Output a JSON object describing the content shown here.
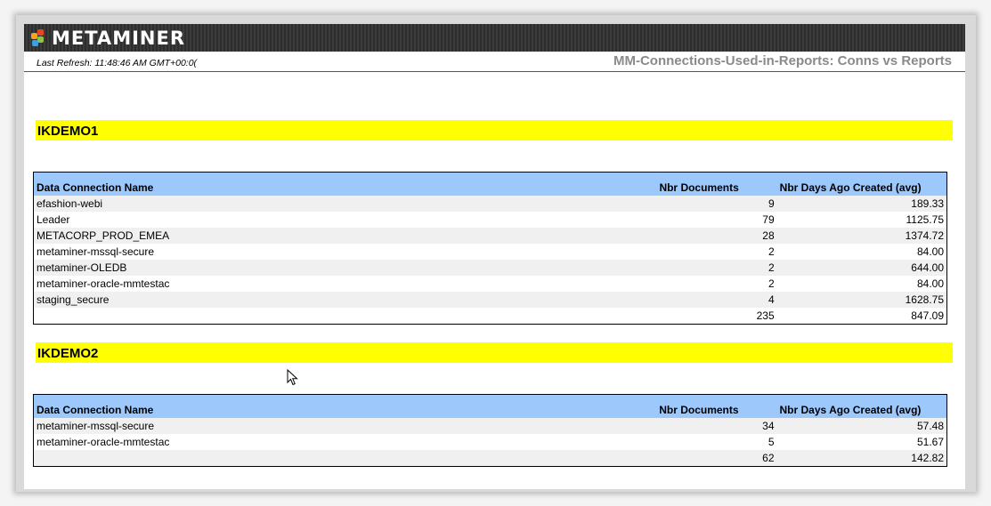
{
  "brand": {
    "name": "METAMINER"
  },
  "header": {
    "last_refresh": "Last Refresh: 11:48:46 AM GMT+00:0(",
    "report_title": "MM-Connections-Used-in-Reports: Conns vs Reports"
  },
  "columns": {
    "name": "Data Connection Name",
    "docs": "Nbr Documents",
    "days": "Nbr Days Ago Created (avg)"
  },
  "sections": [
    {
      "title": "IKDEMO1",
      "rows": [
        {
          "name": "efashion-webi",
          "docs": "9",
          "days": "189.33"
        },
        {
          "name": "Leader",
          "docs": "79",
          "days": "1125.75"
        },
        {
          "name": "METACORP_PROD_EMEA",
          "docs": "28",
          "days": "1374.72"
        },
        {
          "name": "metaminer-mssql-secure",
          "docs": "2",
          "days": "84.00"
        },
        {
          "name": "metaminer-OLEDB",
          "docs": "2",
          "days": "644.00"
        },
        {
          "name": "metaminer-oracle-mmtestac",
          "docs": "2",
          "days": "84.00"
        },
        {
          "name": "staging_secure",
          "docs": "4",
          "days": "1628.75"
        }
      ],
      "total": {
        "docs": "235",
        "days": "847.09"
      }
    },
    {
      "title": "IKDEMO2",
      "rows": [
        {
          "name": "metaminer-mssql-secure",
          "docs": "34",
          "days": "57.48"
        },
        {
          "name": "metaminer-oracle-mmtestac",
          "docs": "5",
          "days": "51.67"
        }
      ],
      "total": {
        "docs": "62",
        "days": "142.82"
      }
    }
  ]
}
